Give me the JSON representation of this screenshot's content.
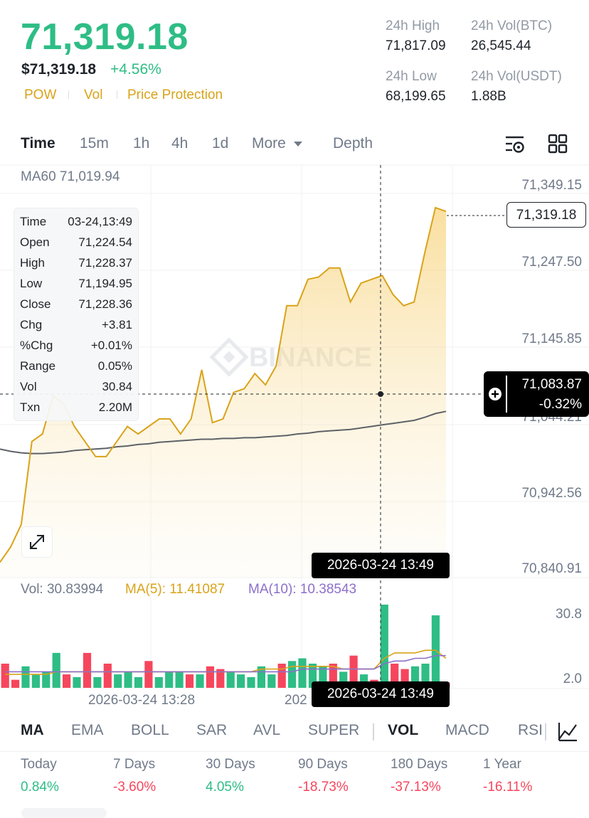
{
  "header": {
    "last_price": "71,319.18",
    "fiat_price": "$71,319.18",
    "change_pct": "+4.56%",
    "tags": [
      "POW",
      "Vol",
      "Price Protection"
    ],
    "stats": [
      {
        "label": "24h High",
        "value": "71,817.09"
      },
      {
        "label": "24h Vol(BTC)",
        "value": "26,545.44"
      },
      {
        "label": "24h Low",
        "value": "68,199.65"
      },
      {
        "label": "24h Vol(USDT)",
        "value": "1.88B"
      }
    ]
  },
  "timeframes": {
    "items": [
      "Time",
      "15m",
      "1h",
      "4h",
      "1d",
      "More",
      "Depth"
    ],
    "active": "Time"
  },
  "chart": {
    "ma60_label": "MA60 71,019.94",
    "watermark": "BINANCE",
    "price_labels": [
      "71,349.15",
      "71,247.50",
      "71,145.85",
      "71,044.21",
      "70,942.56",
      "70,840.91"
    ],
    "last_price_tag": "71,319.18",
    "crosshair_price": "71,083.87",
    "crosshair_change": "-0.32%",
    "crosshair_time": "2026-03-24 13:49",
    "tooltip": [
      {
        "k": "Time",
        "v": "03-24,13:49"
      },
      {
        "k": "Open",
        "v": "71,224.54"
      },
      {
        "k": "High",
        "v": "71,228.37"
      },
      {
        "k": "Low",
        "v": "71,194.95"
      },
      {
        "k": "Close",
        "v": "71,228.36"
      },
      {
        "k": "Chg",
        "v": "+3.81"
      },
      {
        "k": "%Chg",
        "v": "+0.01%"
      },
      {
        "k": "Range",
        "v": "0.05%"
      },
      {
        "k": "Vol",
        "v": "30.84"
      },
      {
        "k": "Txn",
        "v": "2.20M"
      }
    ],
    "vol_label": "Vol: 30.83994",
    "ma5_label": "MA(5): 11.41087",
    "ma10_label": "MA(10): 10.38543",
    "vol_axis": [
      "30.8",
      "2.0"
    ],
    "time_label_1": "2026-03-24 13:28",
    "time_label_2_partial": "202",
    "bottom_time_pill": "2026-03-24 13:49"
  },
  "chart_data": {
    "type": "area",
    "title": "",
    "xlabel": "",
    "ylabel": "",
    "x": [
      "",
      "",
      "",
      "",
      "",
      "",
      "",
      "",
      "",
      "",
      "",
      "",
      "",
      "",
      "",
      "",
      "",
      "",
      "",
      "",
      "",
      "",
      "",
      "",
      "",
      "",
      "",
      "",
      "",
      "",
      "",
      "",
      "",
      "",
      "",
      "",
      "",
      "",
      "",
      "",
      "",
      ""
    ],
    "series": [
      {
        "name": "",
        "color": "#d9a31a",
        "values": [
          70850,
          70870,
          70900,
          71010,
          71020,
          71070,
          71060,
          71030,
          71010,
          70990,
          70990,
          71010,
          71030,
          71020,
          71030,
          71040,
          71040,
          71020,
          71040,
          71105,
          71035,
          71040,
          71075,
          71080,
          71100,
          71085,
          71110,
          71190,
          71190,
          71225,
          71228,
          71240,
          71240,
          71195,
          71220,
          71225,
          71230,
          71205,
          71190,
          71195,
          71260,
          71320,
          71315
        ]
      },
      {
        "name": "MA60",
        "color": "#5e6268",
        "values": [
          71000,
          70997,
          70995,
          70994,
          70994,
          70995,
          70996,
          70998,
          70999,
          71000,
          71001,
          71003,
          71004,
          71006,
          71007,
          71009,
          71010,
          71011,
          71012,
          71013,
          71013,
          71014,
          71014,
          71015,
          71015,
          71016,
          71017,
          71018,
          71020,
          71021,
          71023,
          71024,
          71025,
          71026,
          71028,
          71030,
          71032,
          71034,
          71036,
          71038,
          71042,
          71047,
          71050
        ]
      }
    ],
    "ylim": [
      70840.91,
      71349.15
    ],
    "volume": {
      "values": [
        9,
        3,
        8,
        5,
        6,
        13,
        5,
        4,
        13,
        4,
        9,
        5,
        6,
        4,
        10,
        4,
        6,
        6,
        5,
        5,
        8,
        7,
        6,
        5,
        4,
        8,
        5,
        9,
        10,
        11,
        9,
        8,
        9,
        6,
        12,
        5,
        3,
        31,
        9,
        7,
        8,
        9,
        27,
        2
      ],
      "directions": [
        "down",
        "down",
        "up",
        "up",
        "up",
        "up",
        "down",
        "up",
        "down",
        "up",
        "down",
        "up",
        "up",
        "up",
        "down",
        "up",
        "up",
        "up",
        "down",
        "up",
        "down",
        "down",
        "up",
        "up",
        "up",
        "up",
        "up",
        "down",
        "up",
        "up",
        "up",
        "up",
        "down",
        "up",
        "down",
        "up",
        "down",
        "up",
        "down",
        "down",
        "up",
        "up",
        "up",
        "down"
      ],
      "ma5": [
        5,
        5,
        5,
        5,
        5,
        6,
        6,
        6,
        6,
        6,
        6,
        6,
        6,
        6,
        6,
        6,
        6,
        6,
        6,
        6,
        6,
        6,
        6,
        6,
        6,
        7,
        7,
        7,
        8,
        8,
        8,
        8,
        8,
        7,
        7,
        7,
        7,
        11,
        13,
        13,
        13,
        14,
        14,
        11
      ],
      "ma10": [
        6,
        6,
        6,
        6,
        6,
        6,
        6,
        6,
        6,
        6,
        6,
        6,
        6,
        6,
        6,
        6,
        6,
        6,
        6,
        6,
        6,
        6,
        6,
        6,
        6,
        6,
        6,
        6,
        6,
        7,
        7,
        7,
        7,
        7,
        7,
        7,
        7,
        9,
        10,
        10,
        11,
        11,
        12,
        12
      ],
      "up_color": "#2ebd85",
      "down_color": "#f6465d",
      "ma5_color": "#d9a31a",
      "ma10_color": "#8c6fc9"
    }
  },
  "indicators": {
    "items": [
      "MA",
      "EMA",
      "BOLL",
      "SAR",
      "AVL",
      "SUPER",
      "VOL",
      "MACD",
      "RSI"
    ],
    "active": [
      "MA",
      "VOL"
    ]
  },
  "performance": [
    {
      "label": "Today",
      "value": "0.84%",
      "sign": "pos"
    },
    {
      "label": "7 Days",
      "value": "-3.60%",
      "sign": "neg"
    },
    {
      "label": "30 Days",
      "value": "4.05%",
      "sign": "pos"
    },
    {
      "label": "90 Days",
      "value": "-18.73%",
      "sign": "neg"
    },
    {
      "label": "180 Days",
      "value": "-37.13%",
      "sign": "neg"
    },
    {
      "label": "1 Year",
      "value": "-16.11%",
      "sign": "neg"
    }
  ]
}
